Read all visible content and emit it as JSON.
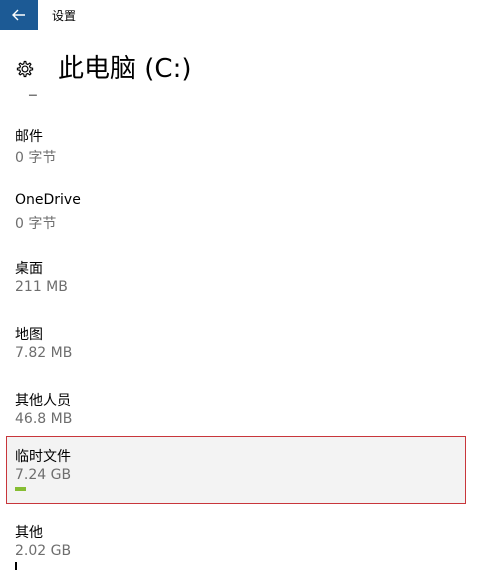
{
  "window": {
    "title": "设置",
    "back_icon": "arrow-left-icon",
    "accent_color": "#1c5a95"
  },
  "header": {
    "icon": "gear-icon",
    "title": "此电脑 (C:)"
  },
  "storage_items": [
    {
      "name": "邮件",
      "size": "0 字节",
      "usage_fraction": 0
    },
    {
      "name": "OneDrive",
      "size": "0 字节",
      "usage_fraction": 0
    },
    {
      "name": "桌面",
      "size": "211 MB",
      "usage_fraction": 0
    },
    {
      "name": "地图",
      "size": "7.82 MB",
      "usage_fraction": 0
    },
    {
      "name": "其他人员",
      "size": "46.8 MB",
      "usage_fraction": 0
    },
    {
      "name": "临时文件",
      "size": "7.24 GB",
      "usage_fraction": 0.025,
      "selected": true
    },
    {
      "name": "其他",
      "size": "2.02 GB",
      "usage_fraction": 0.004
    }
  ],
  "colors": {
    "usage_bar": "#86bd33",
    "selection_border": "#c8363b",
    "secondary_text": "#6e6e6e"
  }
}
